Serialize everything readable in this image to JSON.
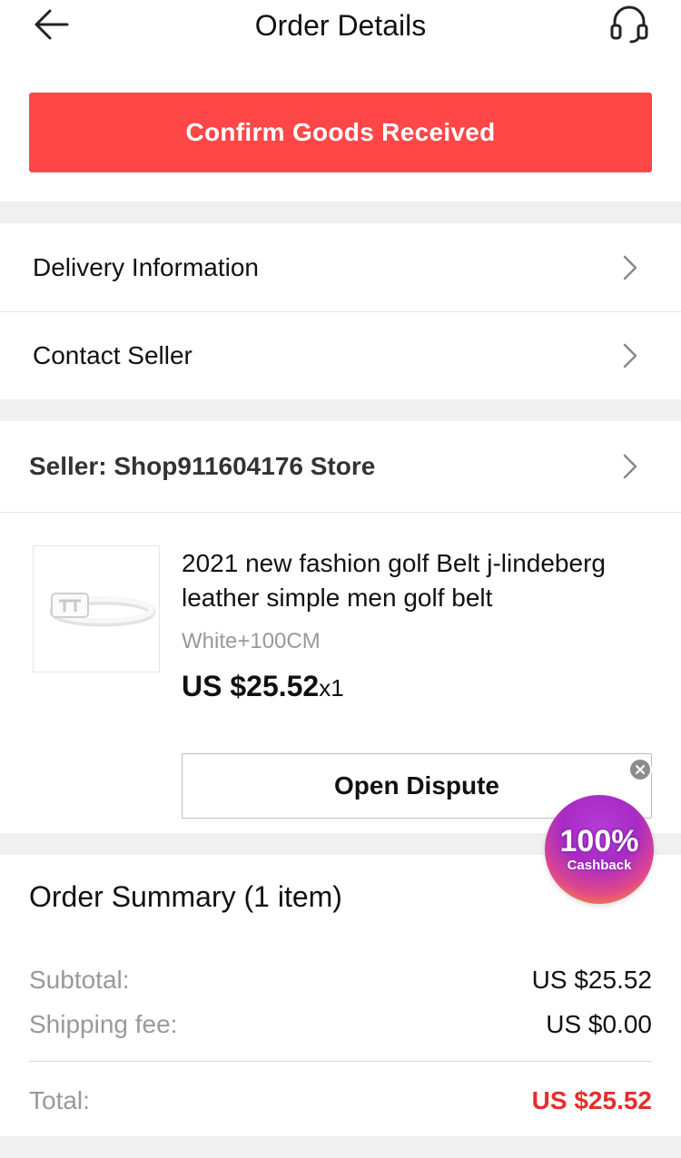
{
  "header": {
    "title": "Order Details",
    "back_icon": "arrow-left-icon",
    "support_icon": "headset-icon"
  },
  "confirm_button": {
    "label": "Confirm Goods Received",
    "color": "#ff4747"
  },
  "menu": {
    "delivery_label": "Delivery Information",
    "contact_label": "Contact Seller"
  },
  "seller": {
    "label": "Seller: Shop911604176 Store"
  },
  "product": {
    "title": "2021 new fashion golf Belt j-lindeberg leather simple men golf belt",
    "variant": "White+100CM",
    "price": "US $25.52",
    "quantity": "x1"
  },
  "dispute_button": {
    "label": "Open Dispute"
  },
  "cashback": {
    "percent": "100%",
    "label": "Cashback"
  },
  "summary": {
    "title": "Order Summary (1 item)",
    "subtotal_label": "Subtotal:",
    "subtotal_value": "US $25.52",
    "shipping_label": "Shipping fee:",
    "shipping_value": "US $0.00",
    "total_label": "Total:",
    "total_value": "US $25.52",
    "total_color": "#e62e2e"
  }
}
